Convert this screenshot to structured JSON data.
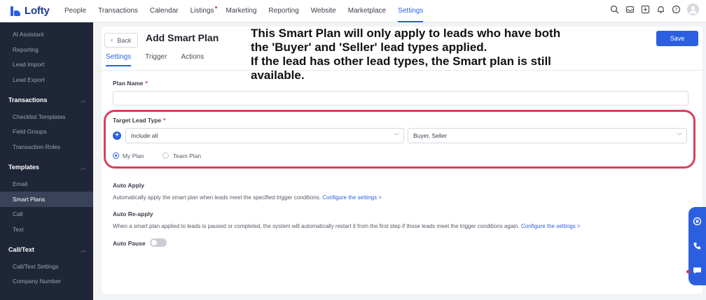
{
  "brand": {
    "name": "Lofty"
  },
  "topnav": {
    "items": [
      {
        "label": "People"
      },
      {
        "label": "Transactions"
      },
      {
        "label": "Calendar"
      },
      {
        "label": "Listings"
      },
      {
        "label": "Marketing"
      },
      {
        "label": "Reporting"
      },
      {
        "label": "Website"
      },
      {
        "label": "Marketplace"
      },
      {
        "label": "Settings"
      }
    ],
    "active": "Settings",
    "icons": [
      "search-icon",
      "inbox-icon",
      "download-icon",
      "bell-icon",
      "help-icon",
      "avatar"
    ]
  },
  "sidebar": {
    "items_top": [
      "AI Assistant",
      "Reporting",
      "Lead Import",
      "Lead Export"
    ],
    "transactions": {
      "title": "Transactions",
      "items": [
        "Checklist Templates",
        "Field Groups",
        "Transaction Roles"
      ]
    },
    "templates": {
      "title": "Templates",
      "items": [
        "Email",
        "Smart Plans",
        "Call",
        "Text"
      ]
    },
    "calltext": {
      "title": "Call/Text",
      "items": [
        "Call/Text Settings",
        "Company Number"
      ]
    },
    "active": "Smart Plans"
  },
  "header": {
    "back_label": "Back",
    "title": "Add Smart Plan",
    "save_label": "Save",
    "tabs": [
      {
        "label": "Settings"
      },
      {
        "label": "Trigger"
      },
      {
        "label": "Actions"
      }
    ],
    "active_tab": "Settings"
  },
  "annotation": {
    "line1": "This Smart Plan will only apply to leads who have both",
    "line2": "the 'Buyer' and 'Seller' lead types applied.",
    "line3": "If the lead has other lead types, the Smart plan is still",
    "line4": "available."
  },
  "form": {
    "plan_name_label": "Plan Name",
    "plan_name_value": "",
    "target_label": "Target Lead Type",
    "include_value": "Include all",
    "lead_types_value": "Buyer, Seller",
    "radio_my": "My Plan",
    "radio_team": "Team Plan",
    "selected_radio": "My Plan",
    "auto_apply_label": "Auto Apply",
    "auto_apply_desc": "Automatically apply the smart plan when leads meet the specified trigger conditions.",
    "auto_apply_link": "Configure the settings >",
    "auto_reapply_label": "Auto Re-apply",
    "auto_reapply_desc": "When a smart plan applied to leads is paused or completed, the system will automatically restart it from the first step if those leads meet the trigger conditions again.",
    "auto_reapply_link": "Configure the settings >",
    "auto_pause_label": "Auto Pause",
    "auto_pause_on": false
  },
  "colors": {
    "accent": "#2c5fe0",
    "sidebar": "#1f2638",
    "highlight": "#d8405c"
  }
}
